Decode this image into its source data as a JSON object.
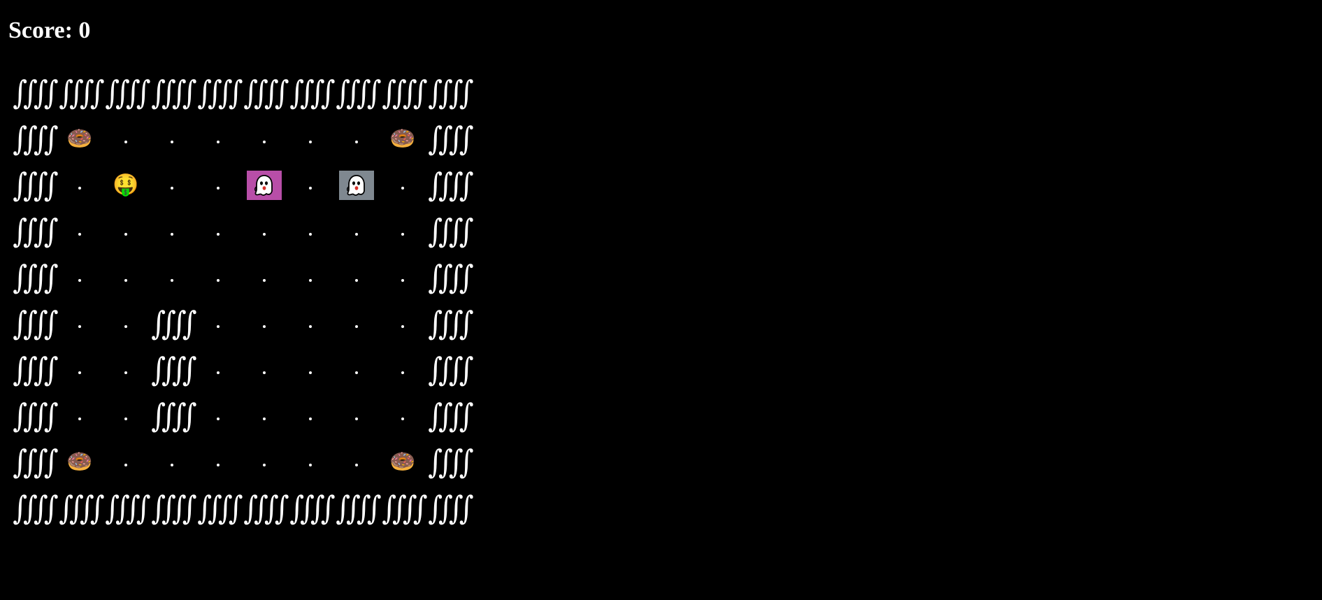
{
  "score": {
    "label": "Score: 0"
  },
  "glyphs": {
    "wall": "∫∫∫∫"
  },
  "legend": {
    "W": "wall",
    ".": "pellet",
    "D": "donut",
    "P": "player",
    "G1": "ghost",
    "G2": "ghost"
  },
  "entities": {
    "donut": {
      "icon": "donut-icon",
      "glyph": "🍩"
    },
    "player": {
      "icon": "money-mouth-face-icon",
      "glyph": "🤑"
    },
    "ghosts": [
      {
        "icon": "ghost-icon",
        "background": "#b84ea8"
      },
      {
        "icon": "ghost-icon",
        "background": "#7f8890"
      }
    ]
  },
  "board": [
    [
      "W",
      "W",
      "W",
      "W",
      "W",
      "W",
      "W",
      "W",
      "W",
      "W"
    ],
    [
      "W",
      "D",
      ".",
      ".",
      ".",
      ".",
      ".",
      ".",
      "D",
      "W"
    ],
    [
      "W",
      ".",
      "P",
      ".",
      ".",
      "G1",
      ".",
      "G2",
      ".",
      "W"
    ],
    [
      "W",
      ".",
      ".",
      ".",
      ".",
      ".",
      ".",
      ".",
      ".",
      "W"
    ],
    [
      "W",
      ".",
      ".",
      ".",
      ".",
      ".",
      ".",
      ".",
      ".",
      "W"
    ],
    [
      "W",
      ".",
      ".",
      "W",
      ".",
      ".",
      ".",
      ".",
      ".",
      "W"
    ],
    [
      "W",
      ".",
      ".",
      "W",
      ".",
      ".",
      ".",
      ".",
      ".",
      "W"
    ],
    [
      "W",
      ".",
      ".",
      "W",
      ".",
      ".",
      ".",
      ".",
      ".",
      "W"
    ],
    [
      "W",
      "D",
      ".",
      ".",
      ".",
      ".",
      ".",
      ".",
      "D",
      "W"
    ],
    [
      "W",
      "W",
      "W",
      "W",
      "W",
      "W",
      "W",
      "W",
      "W",
      "W"
    ]
  ],
  "colors": {
    "background": "#000000",
    "text": "#ffffff"
  }
}
